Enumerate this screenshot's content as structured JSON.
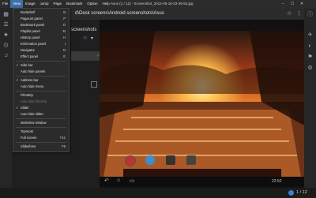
{
  "menubar": {
    "items": [
      "File",
      "View",
      "Image",
      "Jump",
      "Page",
      "Bookmark",
      "Option",
      "Help"
    ],
    "active": "View",
    "title": "Asus (1 / 12) - Screenshot_2012-06-18-23-39-52.jpg",
    "minimize": "–",
    "maximize": "☐",
    "close": "✕"
  },
  "path": {
    "text": "d\\Desk screens\\Android screenshots\\Asus"
  },
  "sidepanel": {
    "title": "screenshots"
  },
  "view_menu": {
    "items": [
      {
        "label": "Bookshelf",
        "shortcut": "B",
        "checked": false,
        "disabled": false
      },
      {
        "label": "PageList panel",
        "shortcut": "P",
        "checked": false,
        "disabled": false
      },
      {
        "label": "Bookmark panel",
        "shortcut": "D",
        "checked": false,
        "disabled": false
      },
      {
        "label": "Playlist panel",
        "shortcut": "M",
        "checked": false,
        "disabled": false
      },
      {
        "label": "History panel",
        "shortcut": "H",
        "checked": false,
        "disabled": false
      },
      {
        "label": "Information panel",
        "shortcut": "I",
        "checked": false,
        "disabled": false
      },
      {
        "label": "Navigator",
        "shortcut": "N",
        "checked": false,
        "disabled": false
      },
      {
        "label": "Effect panel",
        "shortcut": "E",
        "checked": false,
        "disabled": false
      },
      {
        "label": "Side bar",
        "shortcut": "",
        "checked": true,
        "disabled": false
      },
      {
        "label": "Auto hide panels",
        "shortcut": "",
        "checked": false,
        "disabled": false
      },
      {
        "label": "Address bar",
        "shortcut": "",
        "checked": true,
        "disabled": false
      },
      {
        "label": "Auto hide menu",
        "shortcut": "",
        "checked": false,
        "disabled": false
      },
      {
        "label": "Filmstrip",
        "shortcut": "",
        "checked": false,
        "disabled": false
      },
      {
        "label": "Auto hide filmstrip",
        "shortcut": "",
        "checked": false,
        "disabled": true
      },
      {
        "label": "Slider",
        "shortcut": "",
        "checked": true,
        "disabled": false
      },
      {
        "label": "Auto hide slider",
        "shortcut": "",
        "checked": false,
        "disabled": false
      },
      {
        "label": "Mainview window",
        "shortcut": "",
        "checked": false,
        "disabled": false
      },
      {
        "label": "Topmost",
        "shortcut": "",
        "checked": false,
        "disabled": false
      },
      {
        "label": "Full screen",
        "shortcut": "F11",
        "checked": false,
        "disabled": false
      },
      {
        "label": "Slideshow",
        "shortcut": "F5",
        "checked": false,
        "disabled": false
      }
    ]
  },
  "status": {
    "counter": "1 / 12"
  },
  "photo": {
    "timestamp": "22:52"
  }
}
